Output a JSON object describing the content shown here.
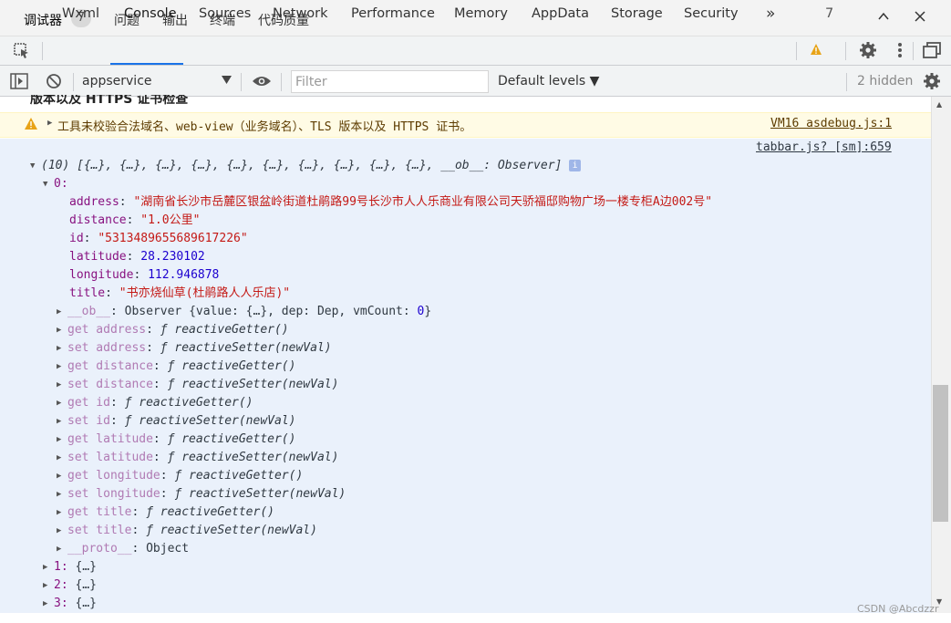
{
  "panel": {
    "tabs": [
      "调试器",
      "问题",
      "输出",
      "终端",
      "代码质量"
    ],
    "badge": "7"
  },
  "devtools": {
    "tabs": [
      "Wxml",
      "Console",
      "Sources",
      "Network",
      "Performance",
      "Memory",
      "AppData",
      "Storage",
      "Security"
    ],
    "active_tab": "Console",
    "more": "»",
    "warning_count": "7"
  },
  "toolbar": {
    "context": "appservice",
    "filter_placeholder": "Filter",
    "levels": "Default levels ▼",
    "hidden": "2 hidden"
  },
  "console": {
    "cut_line": "版本以及 HTTPS 证书检查",
    "warning": {
      "text": "工具未校验合法域名、web-view（业务域名）、TLS 版本以及 HTTPS 证书。",
      "source": "VM16 asdebug.js:1"
    },
    "log_source": "tabbar.js? [sm]:659",
    "array_summary_count": "(10)",
    "array_summary": "[{…}, {…}, {…}, {…}, {…}, {…}, {…}, {…}, {…}, {…}, __ob__: Observer]",
    "item0_key": "0:",
    "props": [
      {
        "key": "address",
        "value": "\"湖南省长沙市岳麓区银盆岭街道杜鹃路99号长沙市人人乐商业有限公司天骄福邸购物广场一楼专柜A边002号\"",
        "type": "s"
      },
      {
        "key": "distance",
        "value": "\"1.0公里\"",
        "type": "s"
      },
      {
        "key": "id",
        "value": "\"5313489655689617226\"",
        "type": "s"
      },
      {
        "key": "latitude",
        "value": "28.230102",
        "type": "n"
      },
      {
        "key": "longitude",
        "value": "112.946878",
        "type": "n"
      },
      {
        "key": "title",
        "value": "\"书亦烧仙草(杜鹃路人人乐店)\"",
        "type": "s"
      }
    ],
    "ob_line": {
      "key": "__ob__",
      "value": "Observer {value: {…}, dep: Dep, vmCount: ",
      "count": "0",
      "close": "}"
    },
    "accessors": [
      {
        "prefix": "get address",
        "fn": "reactiveGetter()"
      },
      {
        "prefix": "set address",
        "fn": "reactiveSetter(newVal)"
      },
      {
        "prefix": "get distance",
        "fn": "reactiveGetter()"
      },
      {
        "prefix": "set distance",
        "fn": "reactiveSetter(newVal)"
      },
      {
        "prefix": "get id",
        "fn": "reactiveGetter()"
      },
      {
        "prefix": "set id",
        "fn": "reactiveSetter(newVal)"
      },
      {
        "prefix": "get latitude",
        "fn": "reactiveGetter()"
      },
      {
        "prefix": "set latitude",
        "fn": "reactiveSetter(newVal)"
      },
      {
        "prefix": "get longitude",
        "fn": "reactiveGetter()"
      },
      {
        "prefix": "set longitude",
        "fn": "reactiveSetter(newVal)"
      },
      {
        "prefix": "get title",
        "fn": "reactiveGetter()"
      },
      {
        "prefix": "set title",
        "fn": "reactiveSetter(newVal)"
      }
    ],
    "proto": {
      "key": "__proto__",
      "value": "Object"
    },
    "items": [
      {
        "key": "1:",
        "value": "{…}"
      },
      {
        "key": "2:",
        "value": "{…}"
      },
      {
        "key": "3:",
        "value": "{…}"
      }
    ],
    "fn_symbol": "ƒ",
    "info_badge": "i"
  },
  "watermark": "CSDN @Abcdzzr"
}
